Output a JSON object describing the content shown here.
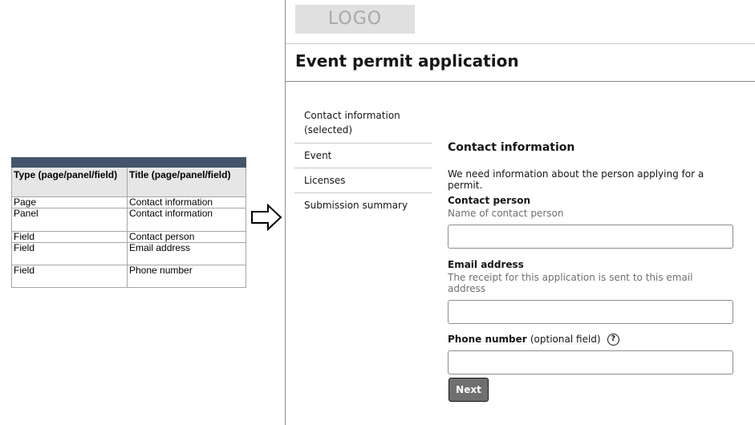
{
  "spec_table": {
    "headers": [
      "Type (page/panel/field)",
      "Title (page/panel/field)"
    ],
    "rows": [
      [
        "Page",
        "Contact information"
      ],
      [
        "Panel",
        "Contact information"
      ],
      [
        "Field",
        "Contact person"
      ],
      [
        "Field",
        "Email address"
      ],
      [
        "Field",
        "Phone number"
      ]
    ],
    "header_band_color": "#44546a"
  },
  "arrow": {
    "icon": "hollow-right-arrow"
  },
  "header": {
    "logo_text": "LOGO",
    "page_title": "Event permit application"
  },
  "nav": {
    "items": [
      {
        "label": "Contact information",
        "status": "(selected)"
      },
      {
        "label": "Event"
      },
      {
        "label": "Licenses"
      },
      {
        "label": "Submission summary"
      }
    ]
  },
  "form": {
    "section_title": "Contact information",
    "section_description": "We need information about the person applying for a permit.",
    "fields": {
      "contact_person": {
        "label": "Contact person",
        "helper": "Name of contact person",
        "value": ""
      },
      "email": {
        "label": "Email address",
        "helper": "The receipt for this application is sent to this email address",
        "value": ""
      },
      "phone": {
        "label": "Phone number",
        "optional": "(optional field)",
        "help_icon": "?",
        "value": ""
      }
    },
    "next_label": "Next"
  }
}
